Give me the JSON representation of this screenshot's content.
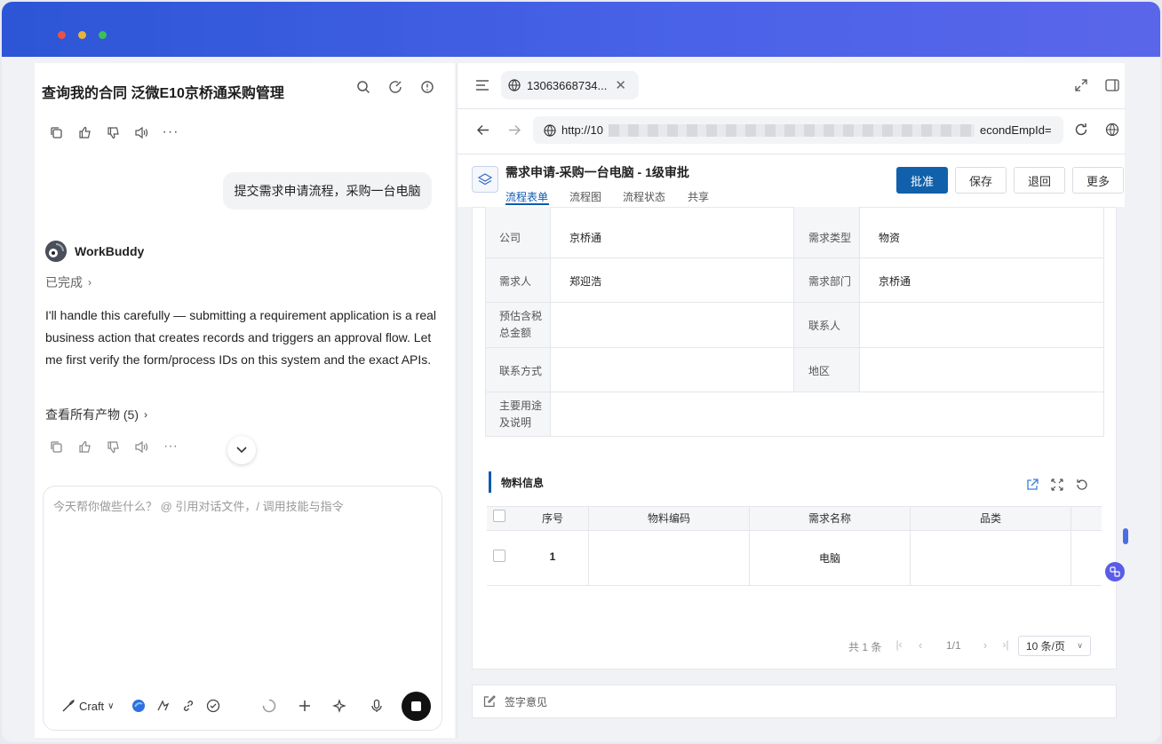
{
  "window": {
    "dots": [
      "#e5534b",
      "#e8b33a",
      "#3fbf5a"
    ]
  },
  "chat": {
    "title": "查询我的合同 泛微E10京桥通采购管理",
    "user_message": "提交需求申请流程，采购一台电脑",
    "assistant_name": "WorkBuddy",
    "status": "已完成",
    "reply": "I'll handle this carefully — submitting a requirement application is a real business action that creates records and triggers an approval flow. Let me first verify the form/process IDs on this system and the exact APIs.",
    "artifacts": "查看所有产物 (5)",
    "composer_placeholder": "今天帮你做些什么？ @ 引用对话文件，/ 调用技能与指令",
    "mode": "Craft"
  },
  "browser": {
    "tab_title": "13063668734...",
    "url_start": "http://10",
    "url_end": "econdEmpId="
  },
  "form": {
    "title": "需求申请-采购一台电脑 - 1级审批",
    "tabs": [
      "流程表单",
      "流程图",
      "流程状态",
      "共享"
    ],
    "actions": {
      "approve": "批准",
      "save": "保存",
      "return": "退回",
      "more": "更多"
    },
    "fields": {
      "company_label": "公司",
      "company_value": "京桥通",
      "type_label": "需求类型",
      "type_value": "物资",
      "requester_label": "需求人",
      "requester_value": "郑迎浩",
      "dept_label": "需求部门",
      "dept_value": "京桥通",
      "amount_label_1": "预估含税",
      "amount_label_2": "总金额",
      "contact_label": "联系人",
      "phone_label": "联系方式",
      "region_label": "地区",
      "purpose_label_1": "主要用途",
      "purpose_label_2": "及说明"
    },
    "materials": {
      "section_title": "物料信息",
      "columns": [
        "序号",
        "物料编码",
        "需求名称",
        "品类"
      ],
      "rows": [
        {
          "index": "1",
          "code": "",
          "name": "电脑",
          "category": ""
        }
      ],
      "pagination": {
        "total": "共 1 条",
        "page": "1/1",
        "page_size": "10 条/页"
      }
    },
    "sign_label": "签字意见"
  }
}
